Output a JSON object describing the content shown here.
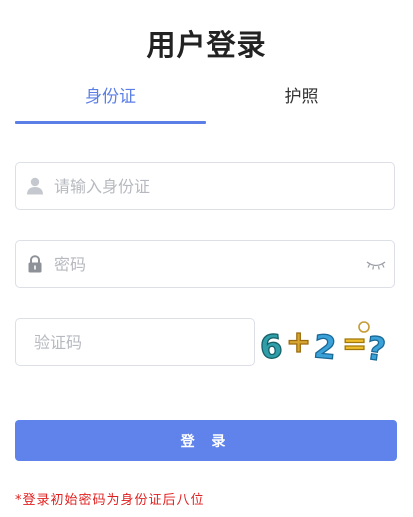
{
  "page": {
    "title": "用户登录"
  },
  "tabs": [
    {
      "label": "身份证",
      "active": true
    },
    {
      "label": "护照",
      "active": false
    }
  ],
  "form": {
    "id_field": {
      "placeholder": "请输入身份证",
      "value": "",
      "icon": "user-icon"
    },
    "password_field": {
      "placeholder": "密码",
      "value": "",
      "icon": "lock-icon",
      "toggle_icon": "eye-closed-icon"
    },
    "captcha_field": {
      "placeholder": "验证码",
      "value": ""
    },
    "captcha_image": {
      "expression": "6+2=?"
    },
    "submit_label": "登 录"
  },
  "notice": {
    "text": "*登录初始密码为身份证后八位",
    "color": "#e02020"
  },
  "colors": {
    "accent": "#5b7fe6",
    "button": "#5f83eb",
    "border": "#dcdfe6",
    "placeholder": "#b6b9bf"
  }
}
